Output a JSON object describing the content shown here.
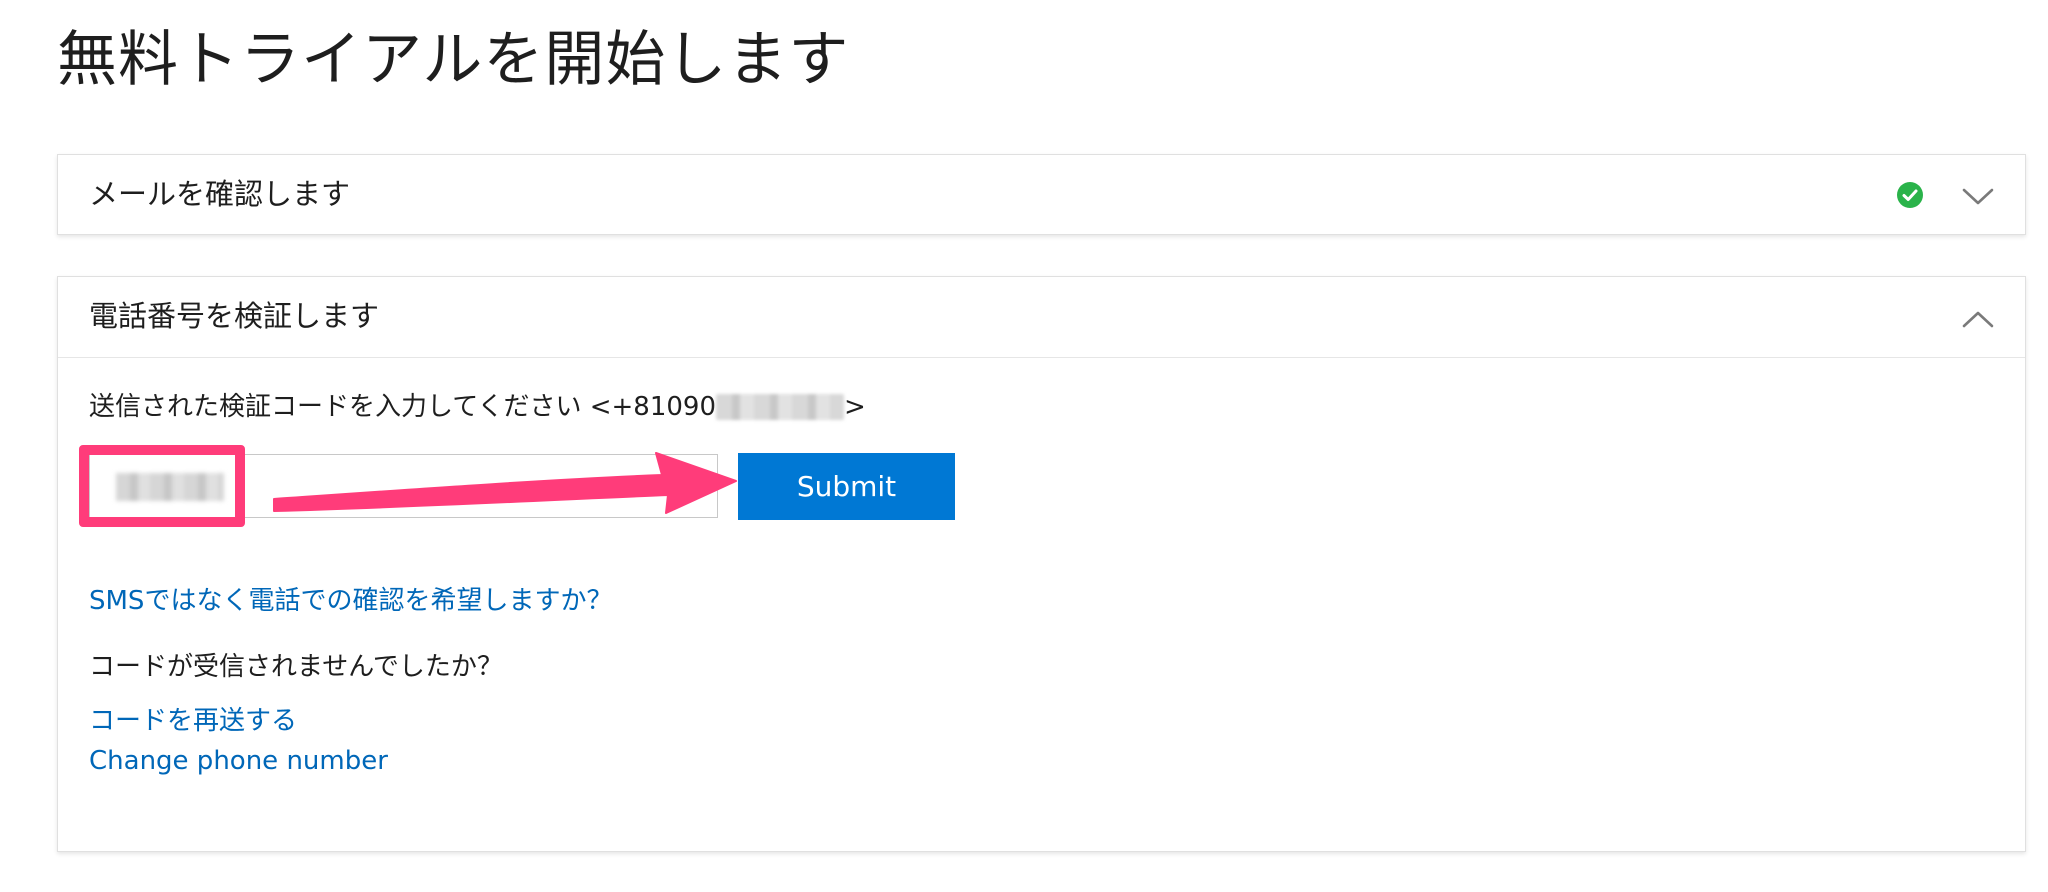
{
  "page": {
    "title": "無料トライアルを開始します"
  },
  "email_step": {
    "title": "メールを確認します",
    "status_icon": "check-circle-icon",
    "status_color": "#2ab34a",
    "toggle_icon": "chevron-down-icon"
  },
  "phone_step": {
    "title": "電話番号を検証します",
    "toggle_icon": "chevron-up-icon",
    "instruction_prefix": "送信された検証コードを入力してください <+81090",
    "instruction_suffix": ">",
    "code_input_value_redacted": true,
    "submit_label": "Submit",
    "voice_link": "SMSではなく電話での確認を希望しますか？",
    "no_code_text": "コードが受信されませんでしたか？",
    "resend_link": "コードを再送する",
    "change_number_link": "Change phone number"
  },
  "colors": {
    "accent": "#0078d4",
    "link": "#0067b8",
    "highlight": "#ff3c7a",
    "success": "#2ab34a"
  }
}
